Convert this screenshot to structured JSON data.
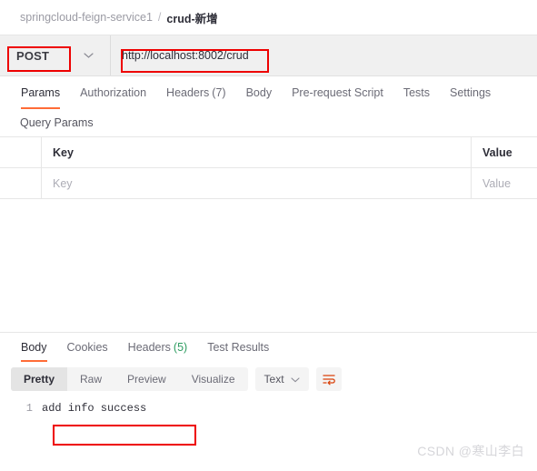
{
  "breadcrumb": {
    "collection": "springcloud-feign-service1",
    "separator": "/",
    "current": "crud-新增"
  },
  "request_bar": {
    "method": "POST",
    "method_chevron_icon": "chevron-down-icon",
    "url": "http://localhost:8002/crud"
  },
  "request_tabs": [
    {
      "label": "Params",
      "active": true
    },
    {
      "label": "Authorization",
      "active": false
    },
    {
      "label": "Headers",
      "count": "(7)",
      "active": false
    },
    {
      "label": "Body",
      "active": false
    },
    {
      "label": "Pre-request Script",
      "active": false
    },
    {
      "label": "Tests",
      "active": false
    },
    {
      "label": "Settings",
      "active": false
    }
  ],
  "query_params": {
    "title": "Query Params",
    "columns": {
      "key": "Key",
      "value": "Value"
    },
    "empty_row": {
      "key_placeholder": "Key",
      "value_placeholder": "Value"
    }
  },
  "response_tabs": [
    {
      "label": "Body",
      "active": true
    },
    {
      "label": "Cookies",
      "active": false
    },
    {
      "label": "Headers",
      "count": "(5)",
      "active": false
    },
    {
      "label": "Test Results",
      "active": false
    }
  ],
  "response_toolbar": {
    "views": [
      {
        "label": "Pretty",
        "active": true
      },
      {
        "label": "Raw",
        "active": false
      },
      {
        "label": "Preview",
        "active": false
      },
      {
        "label": "Visualize",
        "active": false
      }
    ],
    "format": "Text",
    "format_chevron_icon": "chevron-down-icon",
    "wrap_icon": "word-wrap-icon"
  },
  "response_body": {
    "line_number": "1",
    "text": "add info success"
  },
  "watermark": "CSDN @寒山李白",
  "colors": {
    "accent": "#ff6c37",
    "annotation": "#ee0000",
    "count_green": "#2d9c60"
  }
}
